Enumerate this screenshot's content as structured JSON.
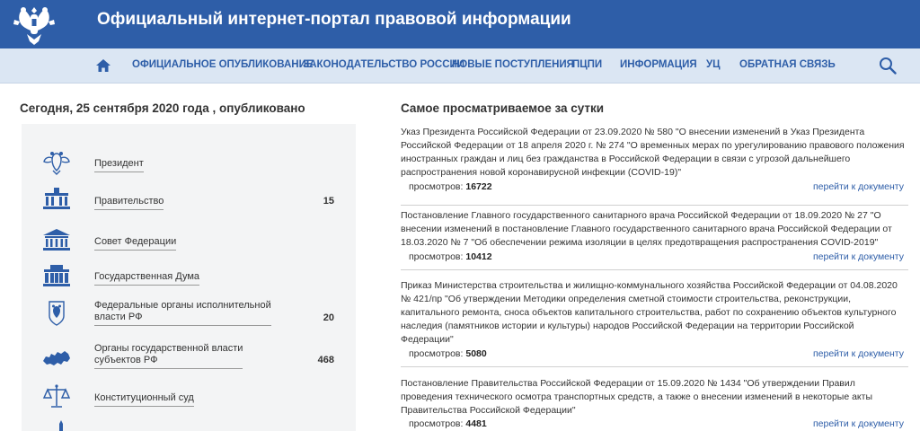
{
  "header": {
    "title": "Официальный интернет-портал правовой информации",
    "emblem_icon": "double-headed-eagle-icon"
  },
  "nav": {
    "home_icon": "home-icon",
    "items": [
      "ОФИЦИАЛЬНОЕ ОПУБЛИКОВАНИЕ",
      "ЗАКОНОДАТЕЛЬСТВО РОССИИ",
      "НОВЫЕ ПОСТУПЛЕНИЯ",
      "ПЦПИ",
      "ИНФОРМАЦИЯ",
      "УЦ",
      "ОБРАТНАЯ СВЯЗЬ"
    ],
    "search_icon": "search-icon"
  },
  "left": {
    "title": "Сегодня, 25 сентября 2020 года , опубликовано",
    "categories": [
      {
        "label": "Президент",
        "count": "",
        "icon": "eagle-icon"
      },
      {
        "label": "Правительство",
        "count": "15",
        "icon": "government-building-icon"
      },
      {
        "label": "Совет Федерации",
        "count": "",
        "icon": "federation-council-building-icon"
      },
      {
        "label": "Государственная Дума",
        "count": "",
        "icon": "state-duma-building-icon"
      },
      {
        "label": "Федеральные органы исполнительной\nвласти РФ",
        "count": "20",
        "icon": "shield-emblem-icon"
      },
      {
        "label": "Органы государственной власти\nсубъектов РФ",
        "count": "468",
        "icon": "russia-map-icon"
      },
      {
        "label": "Конституционный суд",
        "count": "",
        "icon": "scales-icon"
      }
    ]
  },
  "right": {
    "title": "Самое просматриваемое за сутки",
    "views_label": "просмотров:",
    "link_label": "перейти к документу",
    "docs": [
      {
        "text": "Указ Президента Российской Федерации от 23.09.2020 № 580 \"О внесении изменений в Указ Президента Российской Федерации от 18 апреля 2020 г. № 274 \"О временных мерах по урегулированию правового положения иностранных граждан и лиц без гражданства в Российской Федерации в связи с угрозой дальнейшего распространения новой коронавирусной инфекции (COVID-19)\"",
        "views": "16722"
      },
      {
        "text": "Постановление Главного государственного санитарного врача Российской Федерации от 18.09.2020 № 27 \"О внесении изменений в постановление Главного государственного санитарного врача Российской Федерации от 18.03.2020 № 7 \"Об обеспечении режима изоляции в целях предотвращения распространения COVID-2019\"",
        "views": "10412"
      },
      {
        "text": "Приказ Министерства строительства и жилищно-коммунального хозяйства Российской Федерации от 04.08.2020 № 421/пр \"Об утверждении Методики определения сметной стоимости строительства, реконструкции, капитального ремонта, сноса объектов капитального строительства, работ по сохранению объектов культурного наследия (памятников истории и культуры) народов Российской Федерации на территории Российской Федерации\"",
        "views": "5080"
      },
      {
        "text": "Постановление Правительства Российской Федерации от 15.09.2020 № 1434 \"Об утверждении Правил проведения технического осмотра транспортных средств, а также о внесении изменений в некоторые акты Правительства Российской Федерации\"",
        "views": "4481"
      }
    ]
  },
  "colors": {
    "header_bg": "#2e5ea8",
    "nav_bg": "#dbe6f3",
    "link": "#2e5ea8",
    "panel_bg": "#f3f4f5"
  }
}
